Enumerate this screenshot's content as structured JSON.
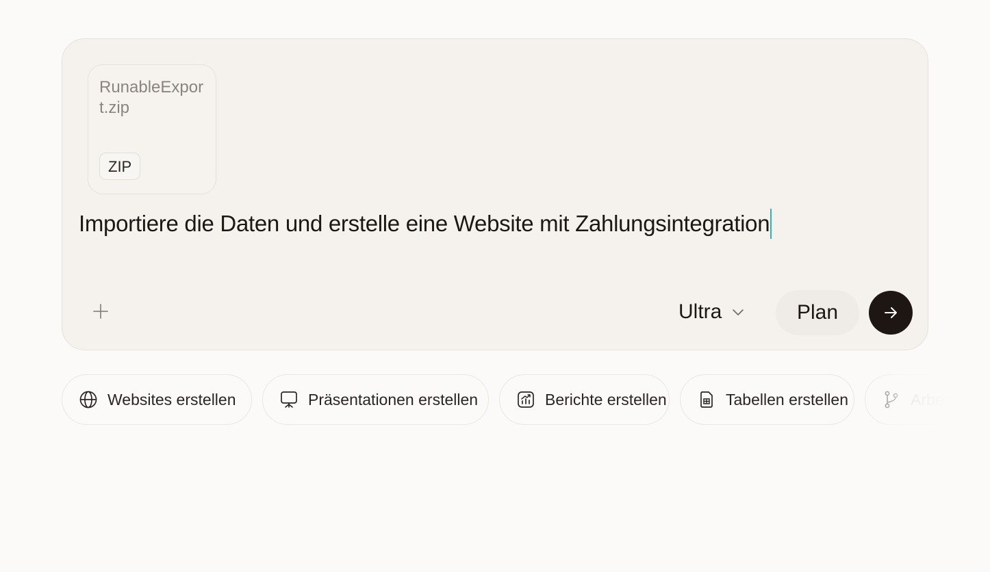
{
  "composer": {
    "attachment": {
      "file_name": "RunableExport.zip",
      "file_type": "ZIP"
    },
    "prompt_text": "Importiere die Daten und erstelle eine Website mit Zahlungsintegration",
    "add_icon": "plus-icon",
    "model_select": {
      "label": "Ultra",
      "icon": "chevron-down-icon"
    },
    "plan_label": "Plan",
    "send_icon": "arrow-right-icon",
    "colors": {
      "background": "#f5f2ee",
      "send_button": "#1e1612",
      "caret": "#1fb7c9"
    }
  },
  "suggestions": [
    {
      "label": "Websites erstellen",
      "icon": "globe-icon"
    },
    {
      "label": "Präsentationen erstellen",
      "icon": "presentation-icon"
    },
    {
      "label": "Berichte erstellen",
      "icon": "report-chart-icon"
    },
    {
      "label": "Tabellen erstellen",
      "icon": "spreadsheet-icon"
    },
    {
      "label": "Arbei",
      "icon": "git-branch-icon"
    }
  ]
}
